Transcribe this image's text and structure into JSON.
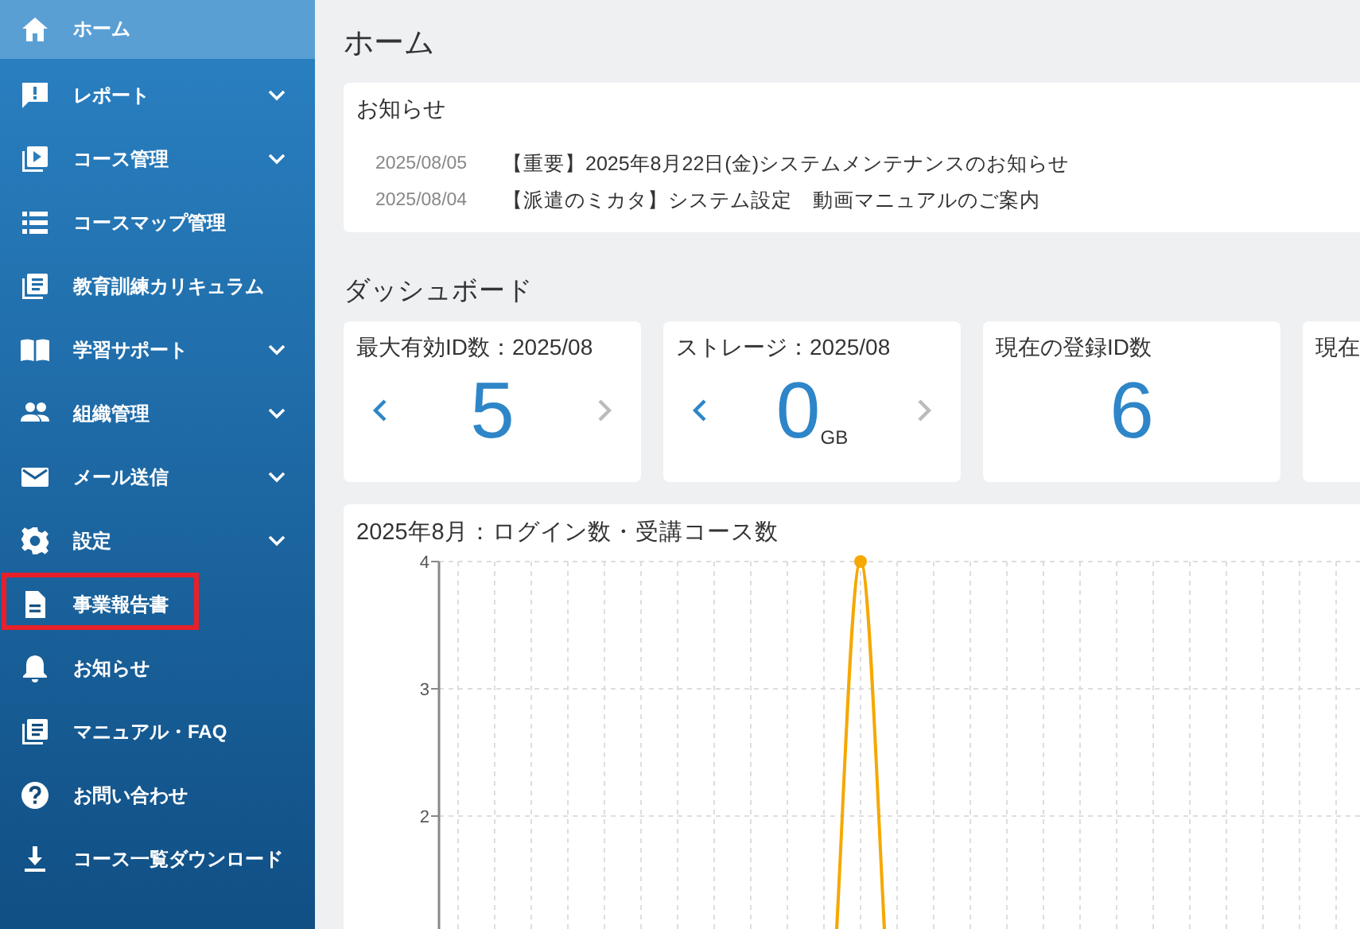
{
  "sidebar": {
    "items": [
      {
        "label": "ホーム",
        "expandable": false,
        "selected": true,
        "highlighted": false
      },
      {
        "label": "レポート",
        "expandable": true,
        "selected": false,
        "highlighted": false
      },
      {
        "label": "コース管理",
        "expandable": true,
        "selected": false,
        "highlighted": false
      },
      {
        "label": "コースマップ管理",
        "expandable": false,
        "selected": false,
        "highlighted": false
      },
      {
        "label": "教育訓練カリキュラム",
        "expandable": false,
        "selected": false,
        "highlighted": false
      },
      {
        "label": "学習サポート",
        "expandable": true,
        "selected": false,
        "highlighted": false
      },
      {
        "label": "組織管理",
        "expandable": true,
        "selected": false,
        "highlighted": false
      },
      {
        "label": "メール送信",
        "expandable": true,
        "selected": false,
        "highlighted": false
      },
      {
        "label": "設定",
        "expandable": true,
        "selected": false,
        "highlighted": false
      },
      {
        "label": "事業報告書",
        "expandable": false,
        "selected": false,
        "highlighted": true
      },
      {
        "label": "お知らせ",
        "expandable": false,
        "selected": false,
        "highlighted": false
      },
      {
        "label": "マニュアル・FAQ",
        "expandable": false,
        "selected": false,
        "highlighted": false
      },
      {
        "label": "お問い合わせ",
        "expandable": false,
        "selected": false,
        "highlighted": false
      },
      {
        "label": "コース一覧ダウンロード",
        "expandable": false,
        "selected": false,
        "highlighted": false
      }
    ]
  },
  "page_title": "ホーム",
  "notices": {
    "title": "お知らせ",
    "items": [
      {
        "date": "2025/08/05",
        "title": "【重要】2025年8月22日(金)システムメンテナンスのお知らせ"
      },
      {
        "date": "2025/08/04",
        "title": "【派遣のミカタ】システム設定　動画マニュアルのご案内"
      }
    ]
  },
  "dashboard": {
    "title": "ダッシュボード",
    "cards": [
      {
        "kind": "paged",
        "title": "最大有効ID数：2025/08",
        "value": "5",
        "prev_disabled": false,
        "next_disabled": true
      },
      {
        "kind": "paged",
        "title": "ストレージ：2025/08",
        "value": "0",
        "unit": "GB",
        "prev_disabled": false,
        "next_disabled": true
      },
      {
        "kind": "plain",
        "title": "現在の登録ID数",
        "value": "6"
      },
      {
        "kind": "plain",
        "title": "現在"
      }
    ]
  },
  "chart": {
    "title": "2025年8月：ログイン数・受講コース数",
    "chart_data": {
      "type": "line",
      "series": [
        {
          "color": "#f5a800",
          "marker": true,
          "values": [
            null,
            null,
            null,
            null,
            null,
            null,
            null,
            null,
            null,
            null,
            0,
            4,
            0,
            null,
            null,
            null,
            null,
            null,
            null,
            null,
            null,
            null,
            null,
            null,
            null,
            null,
            null,
            null,
            null,
            null,
            null
          ]
        }
      ],
      "grid": true,
      "ylim": [
        0,
        4
      ],
      "yticks": [
        2,
        3,
        4
      ]
    }
  }
}
